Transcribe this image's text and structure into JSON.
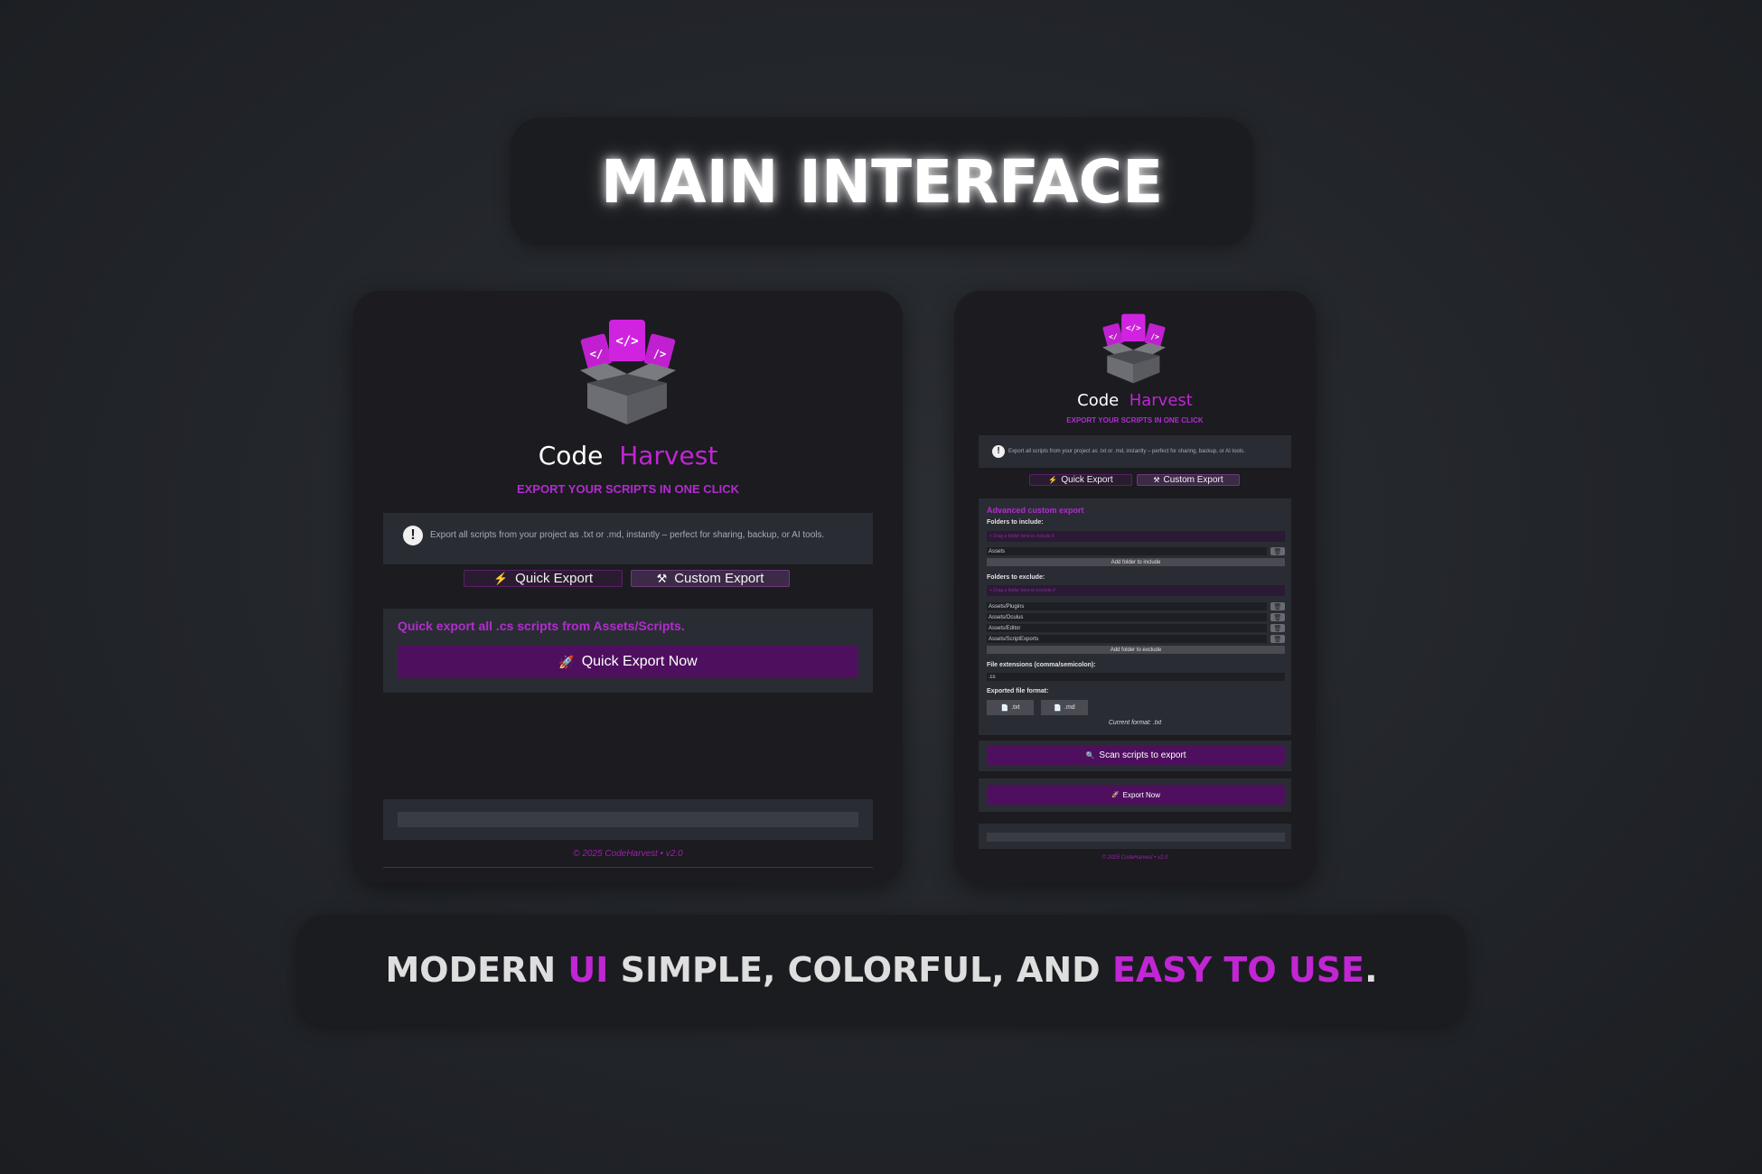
{
  "banner": {
    "title": "MAIN INTERFACE"
  },
  "colors": {
    "accent": "#c026d3",
    "button": "#4e0f5e",
    "panel": "#1b1b20",
    "card": "#2a2c33"
  },
  "app": {
    "name_part1": "Code",
    "name_part2": "Harvest",
    "tagline": "EXPORT YOUR SCRIPTS IN ONE CLICK",
    "info_text": "Export all scripts from your project as .txt or .md, instantly – perfect for sharing, backup, or AI tools.",
    "info_icon": "!",
    "tabs": [
      {
        "label": "Quick Export",
        "icon": "lightning-icon"
      },
      {
        "label": "Custom Export",
        "icon": "tools-icon"
      }
    ],
    "footer": "© 2025 CodeHarvest • v2.0"
  },
  "quick": {
    "description": "Quick export all .cs scripts from Assets/Scripts.",
    "button_label": "Quick Export Now",
    "button_icon": "rocket-icon",
    "progress": 0
  },
  "custom": {
    "section_title": "Advanced custom export",
    "include_label": "Folders to include:",
    "include_drop_placeholder": "+ Drag a folder here to include it",
    "include_folders": [
      "Assets"
    ],
    "add_include_label": "Add folder to include",
    "exclude_label": "Folders to exclude:",
    "exclude_drop_placeholder": "+ Drag a folder here to exclude it",
    "exclude_folders": [
      "Assets/Plugins",
      "Assets/Oculus",
      "Assets/Editor",
      "Assets/ScriptExports"
    ],
    "add_exclude_label": "Add folder to exclude",
    "extensions_label": "File extensions (comma/semicolon):",
    "extensions_value": ".cs",
    "format_label": "Exported file format:",
    "formats": [
      ".txt",
      ".md"
    ],
    "current_format": "Current format: .txt",
    "scan_label": "Scan scripts to export",
    "export_label": "Export Now",
    "progress": 0
  },
  "tagline_bottom": {
    "w1": "MODERN ",
    "p1": "UI",
    "w2": " SIMPLE, COLORFUL, AND ",
    "p2": "EASY TO USE",
    "w3": "."
  }
}
